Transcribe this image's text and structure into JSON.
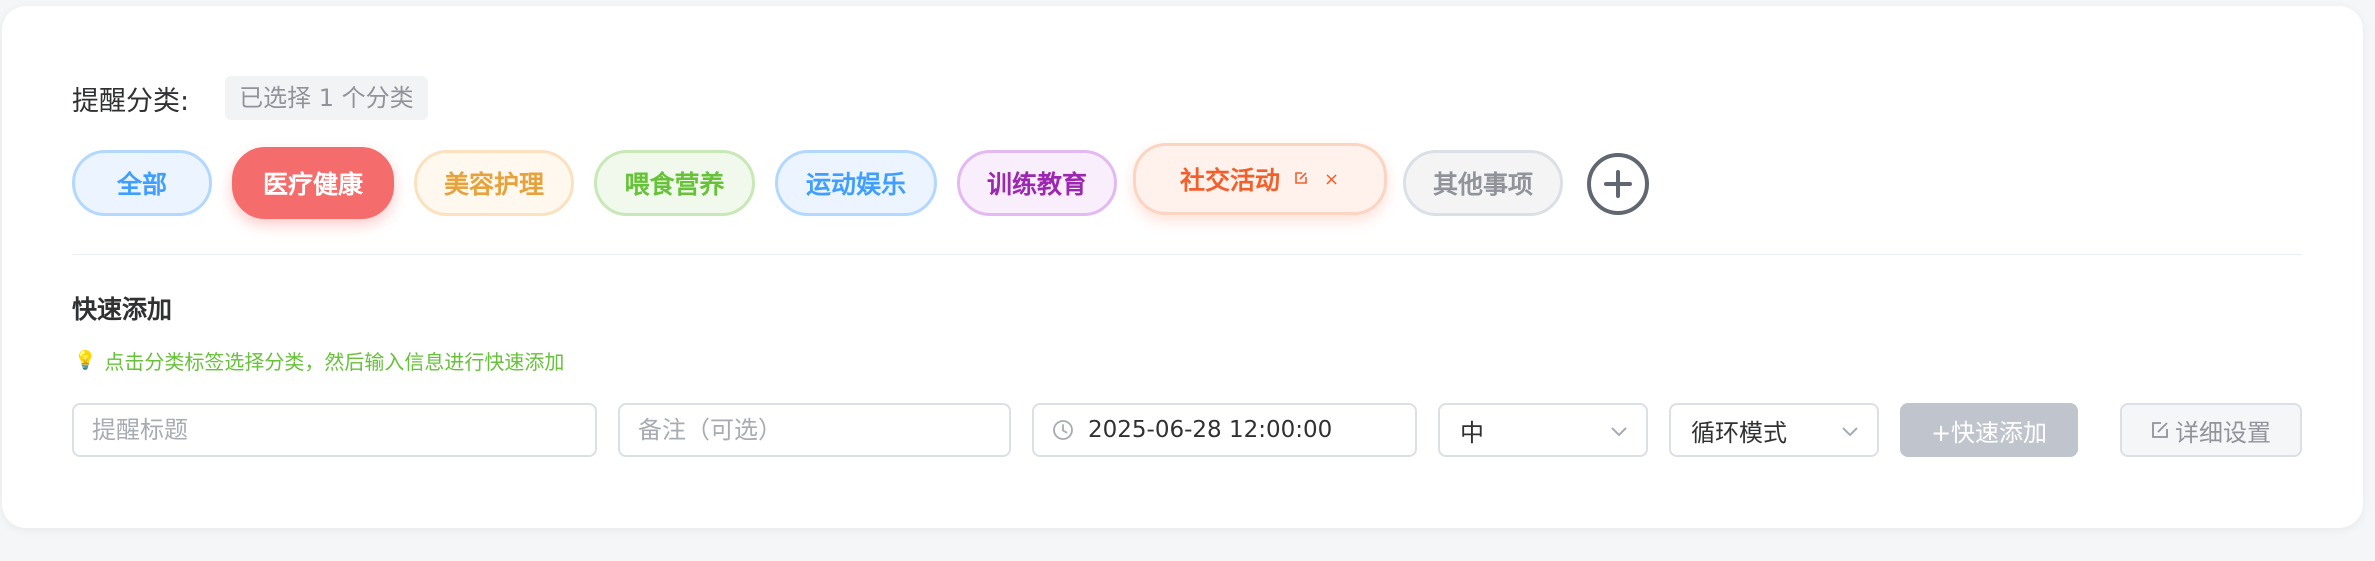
{
  "category": {
    "label": "提醒分类:",
    "selected_count": "已选择 1 个分类",
    "tags": [
      {
        "label": "全部"
      },
      {
        "label": "医疗健康"
      },
      {
        "label": "美容护理"
      },
      {
        "label": "喂食营养"
      },
      {
        "label": "运动娱乐"
      },
      {
        "label": "训练教育"
      },
      {
        "label": "社交活动",
        "edit_icon": "edit-icon",
        "close_symbol": "×"
      },
      {
        "label": "其他事项"
      }
    ],
    "add_icon": "plus-circle-icon"
  },
  "quick_add": {
    "title": "快速添加",
    "tip": "点击分类标签选择分类，然后输入信息进行快速添加",
    "tip_icon": "lightbulb-icon",
    "title_placeholder": "提醒标题",
    "note_placeholder": "备注（可选）",
    "datetime": "2025-06-28 12:00:00",
    "priority": "中",
    "repeat_mode": "循环模式",
    "quick_add_button": "+快速添加",
    "detail_button": "详细设置"
  },
  "colors": {
    "medical": "#f56c6c",
    "social": "#f35f2b",
    "primary": "#409eff",
    "success": "#67c23a"
  }
}
